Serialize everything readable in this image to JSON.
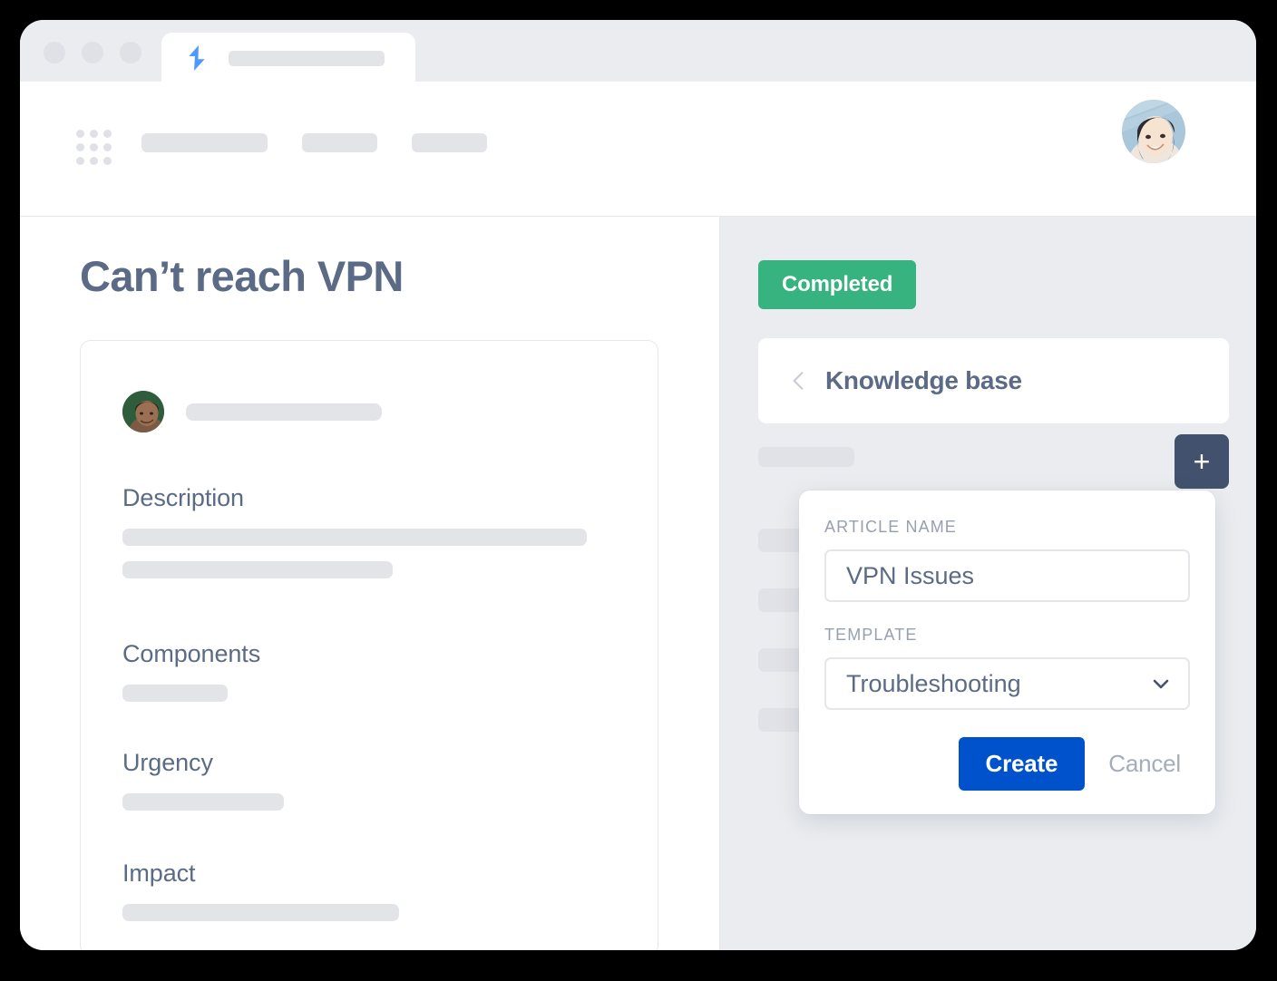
{
  "browser": {
    "favicon": "lightning-bolt-icon",
    "favicon_color": "#4c9aff",
    "tab_title": "",
    "traffic_lights": [
      "close",
      "minimize",
      "maximize"
    ]
  },
  "app_header": {
    "app_switcher_icon": "grid-dots-icon",
    "nav_items": [
      "",
      "",
      ""
    ],
    "avatar": "user-avatar"
  },
  "issue": {
    "title": "Can’t reach VPN",
    "reporter_name": "",
    "fields": [
      {
        "label": "Description",
        "values": [
          "",
          ""
        ]
      },
      {
        "label": "Components",
        "values": [
          ""
        ]
      },
      {
        "label": "Urgency",
        "values": [
          ""
        ]
      },
      {
        "label": "Impact",
        "values": [
          ""
        ]
      }
    ]
  },
  "sidebar": {
    "status_badge": "Completed",
    "status_color": "#36b37e",
    "back_icon": "chevron-left-icon",
    "panel_title": "Knowledge base",
    "toolbar_label": "",
    "add_button": {
      "icon": "plus-icon",
      "label": "+",
      "color": "#42526e"
    },
    "article_rows": [
      "",
      "",
      "",
      ""
    ]
  },
  "dialog": {
    "article_name_label": "ARTICLE NAME",
    "article_name_value": "VPN Issues",
    "article_name_placeholder": "Article name",
    "template_label": "TEMPLATE",
    "template_value": "Troubleshooting",
    "template_options": [
      "Troubleshooting"
    ],
    "chevron_icon": "chevron-down-icon",
    "create_label": "Create",
    "create_color": "#0052cc",
    "cancel_label": "Cancel"
  }
}
